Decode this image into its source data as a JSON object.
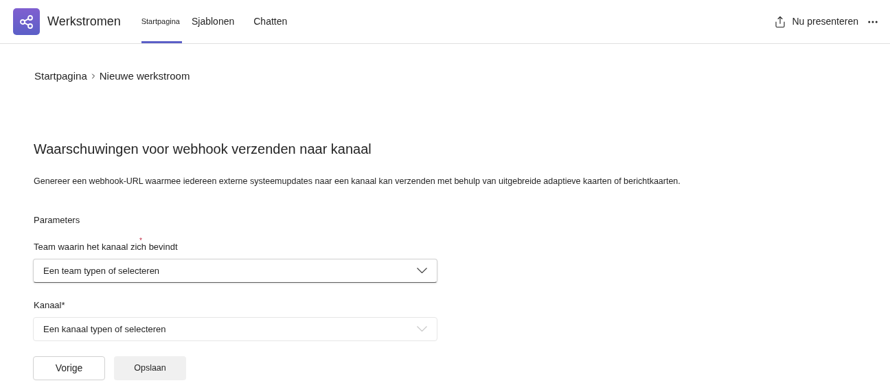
{
  "app": {
    "title": "Werkstromen"
  },
  "tabs": [
    {
      "label": "Startpagina",
      "selected": true
    },
    {
      "label": "Sjablonen",
      "selected": false
    },
    {
      "label": "Chatten",
      "selected": false
    }
  ],
  "present_button": {
    "label": "Nu presenteren"
  },
  "breadcrumb": [
    "Startpagina",
    "Nieuwe werkstroom"
  ],
  "heading": "Waarschuwingen voor webhook verzenden naar kanaal",
  "description": "Genereer een webhook-URL waarmee iedereen externe systeemupdates naar een kanaal kan verzenden met behulp van uitgebreide adaptieve kaarten of berichtkaarten.",
  "section_label": "Parameters",
  "fields": [
    {
      "label": "Team waarin het kanaal zich bevindt",
      "required_mark": "*",
      "placeholder": "Een team typen of selecteren",
      "disabled": false
    },
    {
      "label": "Kanaal*",
      "placeholder": "Een kanaal typen of selecteren",
      "disabled": true
    }
  ],
  "buttons": [
    {
      "label": "Vorige",
      "disabled": false
    },
    {
      "label": "Opslaan",
      "disabled": true
    }
  ]
}
